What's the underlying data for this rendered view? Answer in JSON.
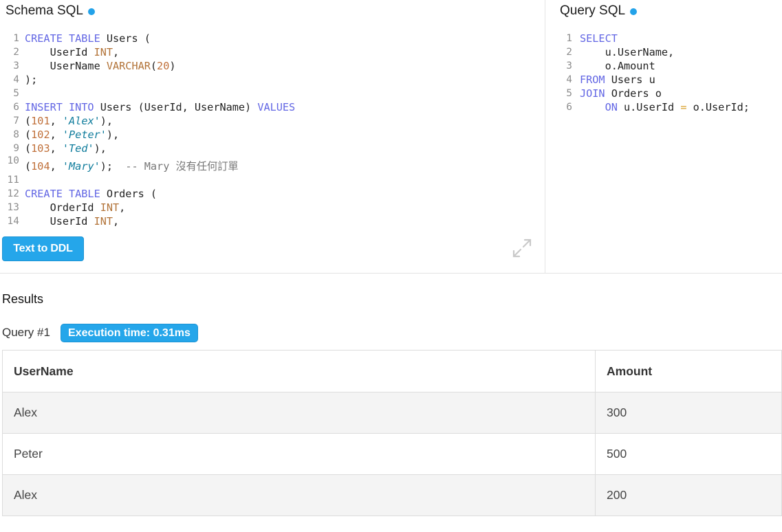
{
  "schema_panel": {
    "title": "Schema SQL",
    "lines": [
      {
        "num": "1",
        "tokens": [
          {
            "text": "CREATE TABLE",
            "cls": "k"
          },
          {
            "text": " Users (",
            "cls": ""
          }
        ]
      },
      {
        "num": "2",
        "tokens": [
          {
            "text": "    UserId ",
            "cls": ""
          },
          {
            "text": "INT",
            "cls": "t"
          },
          {
            "text": ",",
            "cls": ""
          }
        ]
      },
      {
        "num": "3",
        "tokens": [
          {
            "text": "    UserName ",
            "cls": ""
          },
          {
            "text": "VARCHAR",
            "cls": "t"
          },
          {
            "text": "(",
            "cls": ""
          },
          {
            "text": "20",
            "cls": "n"
          },
          {
            "text": ")",
            "cls": ""
          }
        ]
      },
      {
        "num": "4",
        "tokens": [
          {
            "text": ");",
            "cls": ""
          }
        ]
      },
      {
        "num": "5",
        "tokens": []
      },
      {
        "num": "6",
        "tokens": [
          {
            "text": "INSERT INTO",
            "cls": "k"
          },
          {
            "text": " Users (UserId, UserName) ",
            "cls": ""
          },
          {
            "text": "VALUES",
            "cls": "k"
          }
        ]
      },
      {
        "num": "7",
        "tokens": [
          {
            "text": "(",
            "cls": ""
          },
          {
            "text": "101",
            "cls": "n"
          },
          {
            "text": ", ",
            "cls": ""
          },
          {
            "text": "'Alex'",
            "cls": "s"
          },
          {
            "text": "),",
            "cls": ""
          }
        ]
      },
      {
        "num": "8",
        "tokens": [
          {
            "text": "(",
            "cls": ""
          },
          {
            "text": "102",
            "cls": "n"
          },
          {
            "text": ", ",
            "cls": ""
          },
          {
            "text": "'Peter'",
            "cls": "s"
          },
          {
            "text": "),",
            "cls": ""
          }
        ]
      },
      {
        "num": "9",
        "tokens": [
          {
            "text": "(",
            "cls": ""
          },
          {
            "text": "103",
            "cls": "n"
          },
          {
            "text": ", ",
            "cls": ""
          },
          {
            "text": "'Ted'",
            "cls": "s"
          },
          {
            "text": "),",
            "cls": ""
          }
        ]
      },
      {
        "num": "10",
        "tall": true,
        "tokens": [
          {
            "text": "(",
            "cls": ""
          },
          {
            "text": "104",
            "cls": "n"
          },
          {
            "text": ", ",
            "cls": ""
          },
          {
            "text": "'Mary'",
            "cls": "s"
          },
          {
            "text": ");  ",
            "cls": ""
          },
          {
            "text": "-- Mary 沒有任何訂單",
            "cls": "c"
          }
        ]
      },
      {
        "num": "11",
        "tokens": []
      },
      {
        "num": "12",
        "tokens": [
          {
            "text": "CREATE TABLE",
            "cls": "k"
          },
          {
            "text": " Orders (",
            "cls": ""
          }
        ]
      },
      {
        "num": "13",
        "tokens": [
          {
            "text": "    OrderId ",
            "cls": ""
          },
          {
            "text": "INT",
            "cls": "t"
          },
          {
            "text": ",",
            "cls": ""
          }
        ]
      },
      {
        "num": "14",
        "tokens": [
          {
            "text": "    UserId ",
            "cls": ""
          },
          {
            "text": "INT",
            "cls": "t"
          },
          {
            "text": ",",
            "cls": ""
          }
        ]
      }
    ],
    "text_to_ddl_label": "Text to DDL",
    "expand_icon": "expand-arrows-icon"
  },
  "query_panel": {
    "title": "Query SQL",
    "lines": [
      {
        "num": "1",
        "tokens": [
          {
            "text": "SELECT",
            "cls": "k"
          }
        ]
      },
      {
        "num": "2",
        "tokens": [
          {
            "text": "    u.UserName,",
            "cls": ""
          }
        ]
      },
      {
        "num": "3",
        "tokens": [
          {
            "text": "    o.Amount",
            "cls": ""
          }
        ]
      },
      {
        "num": "4",
        "tokens": [
          {
            "text": "FROM",
            "cls": "k"
          },
          {
            "text": " Users u",
            "cls": ""
          }
        ]
      },
      {
        "num": "5",
        "tokens": [
          {
            "text": "JOIN",
            "cls": "k"
          },
          {
            "text": " Orders o",
            "cls": ""
          }
        ]
      },
      {
        "num": "6",
        "tokens": [
          {
            "text": "    ",
            "cls": ""
          },
          {
            "text": "ON",
            "cls": "k"
          },
          {
            "text": " u.UserId ",
            "cls": ""
          },
          {
            "text": "=",
            "cls": "o"
          },
          {
            "text": " o.UserId;",
            "cls": ""
          }
        ]
      }
    ]
  },
  "results": {
    "title": "Results",
    "query_label": "Query #1",
    "execution_time": "Execution time: 0.31ms",
    "columns": [
      "UserName",
      "Amount"
    ],
    "rows": [
      [
        "Alex",
        "300"
      ],
      [
        "Peter",
        "500"
      ],
      [
        "Alex",
        "200"
      ]
    ]
  },
  "colors": {
    "accent": "#25a6ea",
    "keyword": "#6266e4",
    "type": "#b27338",
    "number": "#c0703a",
    "string": "#0f7c9c",
    "comment": "#777777"
  }
}
